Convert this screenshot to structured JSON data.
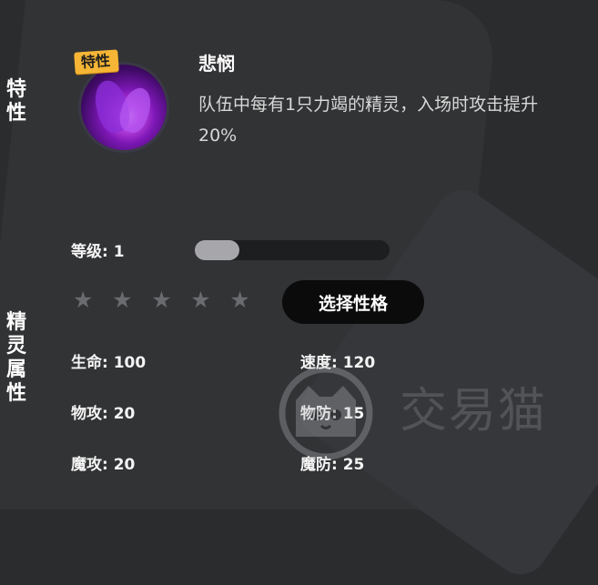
{
  "section_labels": {
    "trait": [
      "特",
      "性"
    ],
    "attributes": [
      "精",
      "灵",
      "属",
      "性"
    ]
  },
  "trait": {
    "badge": "特性",
    "name": "悲悯",
    "description": "队伍中每有1只力竭的精灵，入场时攻击提升20%",
    "icon": "purple-flame-icon"
  },
  "level": {
    "label": "等级: 1",
    "progress_fraction": 0.23
  },
  "rating": {
    "stars_total": 5,
    "stars_filled": 0,
    "star_glyph": "★"
  },
  "actions": {
    "select_personality": "选择性格"
  },
  "stats": {
    "hp": "生命: 100",
    "speed": "速度: 120",
    "attack": "物攻: 20",
    "defense": "物防: 15",
    "magic_attack": "魔攻: 20",
    "magic_defense": "魔防: 25"
  },
  "watermark": {
    "text": "交易猫",
    "icon": "cat-logo-icon"
  },
  "colors": {
    "background": "#2b2c2e",
    "badge": "#f6b534",
    "button": "#0b0b0b",
    "star_inactive": "#6a6b6e"
  }
}
